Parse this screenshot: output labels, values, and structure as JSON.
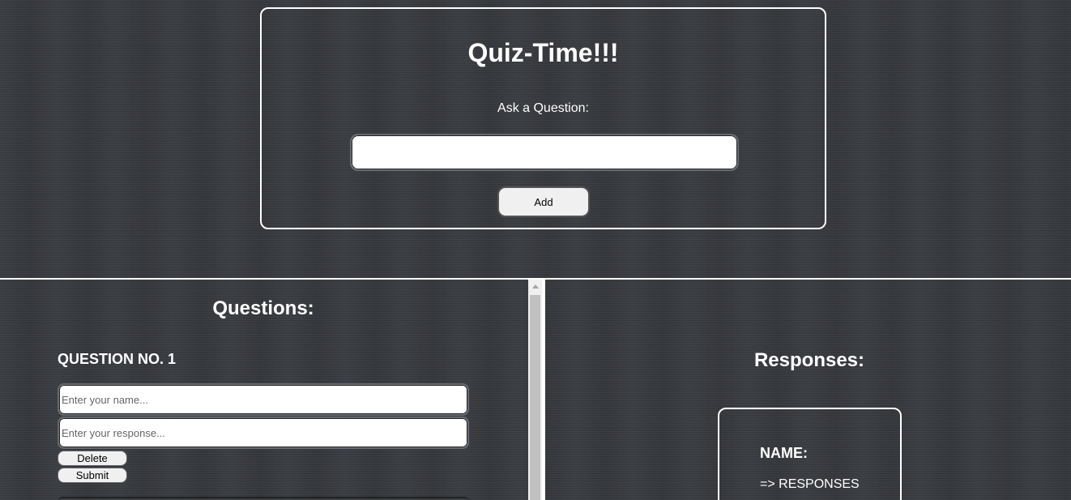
{
  "header": {
    "title": "Quiz-Time!!!",
    "ask_label": "Ask a Question:",
    "question_value": "",
    "add_label": "Add"
  },
  "questions": {
    "heading": "Questions:",
    "items": [
      {
        "number_label": "QUESTION NO. 1",
        "name_placeholder": "Enter your name...",
        "response_placeholder": "Enter your response...",
        "delete_label": "Delete",
        "submit_label": "Submit"
      }
    ]
  },
  "responses": {
    "heading": "Responses:",
    "card": {
      "name_label": "NAME:",
      "responses_label": "=> RESPONSES"
    }
  },
  "colors": {
    "background": "#35383c",
    "border": "#ffffff",
    "button": "#f0f0f0"
  }
}
